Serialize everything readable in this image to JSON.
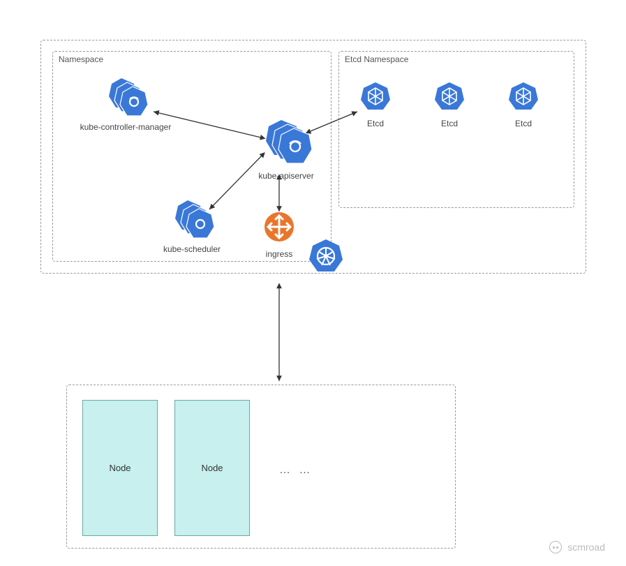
{
  "outerCluster": {
    "namespaceBox": {
      "label": "Namespace"
    },
    "etcdBox": {
      "label": "Etcd Namespace"
    }
  },
  "components": {
    "controllerManager": {
      "label": "kube-controller-manager"
    },
    "apiserver": {
      "label": "kube-apiserver"
    },
    "scheduler": {
      "label": "kube-scheduler"
    },
    "ingress": {
      "label": "ingress"
    },
    "etcd1": {
      "label": "Etcd"
    },
    "etcd2": {
      "label": "Etcd"
    },
    "etcd3": {
      "label": "Etcd"
    }
  },
  "workerCluster": {
    "nodes": [
      "Node",
      "Node"
    ],
    "ellipsis": "…  …"
  },
  "watermark": {
    "text": "scmroad"
  },
  "colors": {
    "k8sBlue": "#3A78D8",
    "ingressOrange": "#E8762C",
    "nodeFill": "#C7F0EE"
  }
}
